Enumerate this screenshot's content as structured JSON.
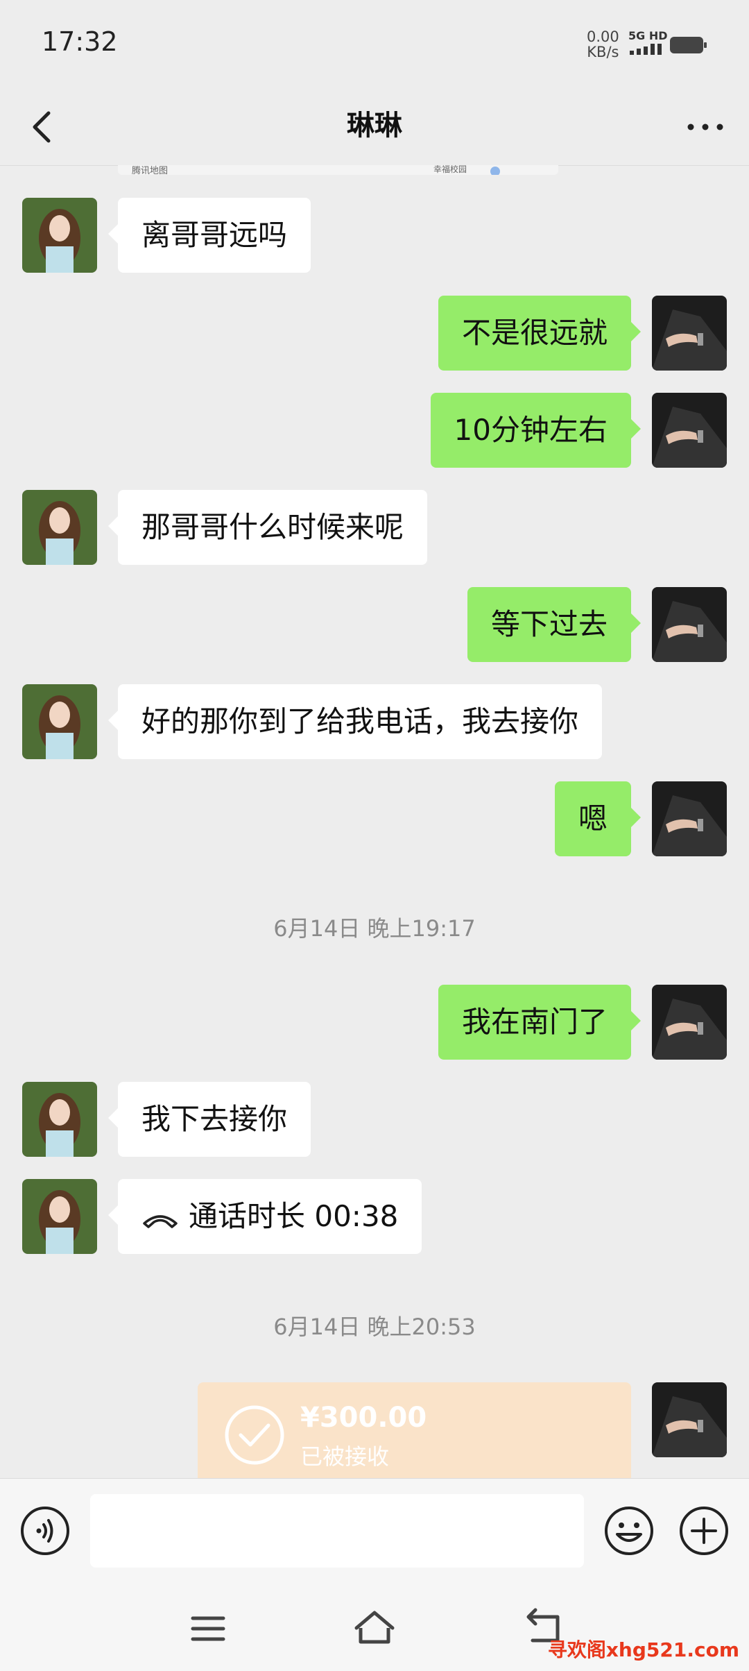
{
  "status_bar": {
    "time": "17:32",
    "net_speed_value": "0.00",
    "net_speed_unit": "KB/s",
    "network_label": "5G HD"
  },
  "header": {
    "title": "琳琳"
  },
  "map_card": {
    "source_label": "腾讯地图",
    "place_label": "幸福校园"
  },
  "messages": [
    {
      "side": "in",
      "text": "离哥哥远吗"
    },
    {
      "side": "out",
      "text": "不是很远就"
    },
    {
      "side": "out",
      "text": "10分钟左右"
    },
    {
      "side": "in",
      "text": "那哥哥什么时候来呢"
    },
    {
      "side": "out",
      "text": "等下过去"
    },
    {
      "side": "in",
      "text": "好的那你到了给我电话，我去接你"
    },
    {
      "side": "out",
      "text": "嗯"
    },
    {
      "side": "out",
      "text": "我在南门了"
    },
    {
      "side": "in",
      "text": "我下去接你"
    },
    {
      "side": "in",
      "text": "通话时长 00:38"
    }
  ],
  "time_separators": [
    "6月14日 晚上19:17",
    "6月14日 晚上20:53"
  ],
  "transfer": {
    "amount": "¥300.00",
    "status": "已被接收"
  },
  "input": {
    "value": "",
    "placeholder": ""
  },
  "watermark": "寻欢阁xhg521.com",
  "colors": {
    "background": "#ededed",
    "outgoing_bubble": "#95ec69",
    "incoming_bubble": "#ffffff",
    "transfer_card": "#fae3c9",
    "watermark": "#e8381c"
  },
  "icons": [
    "back-icon",
    "more-icon",
    "call-icon",
    "check-icon",
    "voice-icon",
    "emoji-icon",
    "plus-icon",
    "menu-icon",
    "home-icon",
    "return-icon"
  ]
}
